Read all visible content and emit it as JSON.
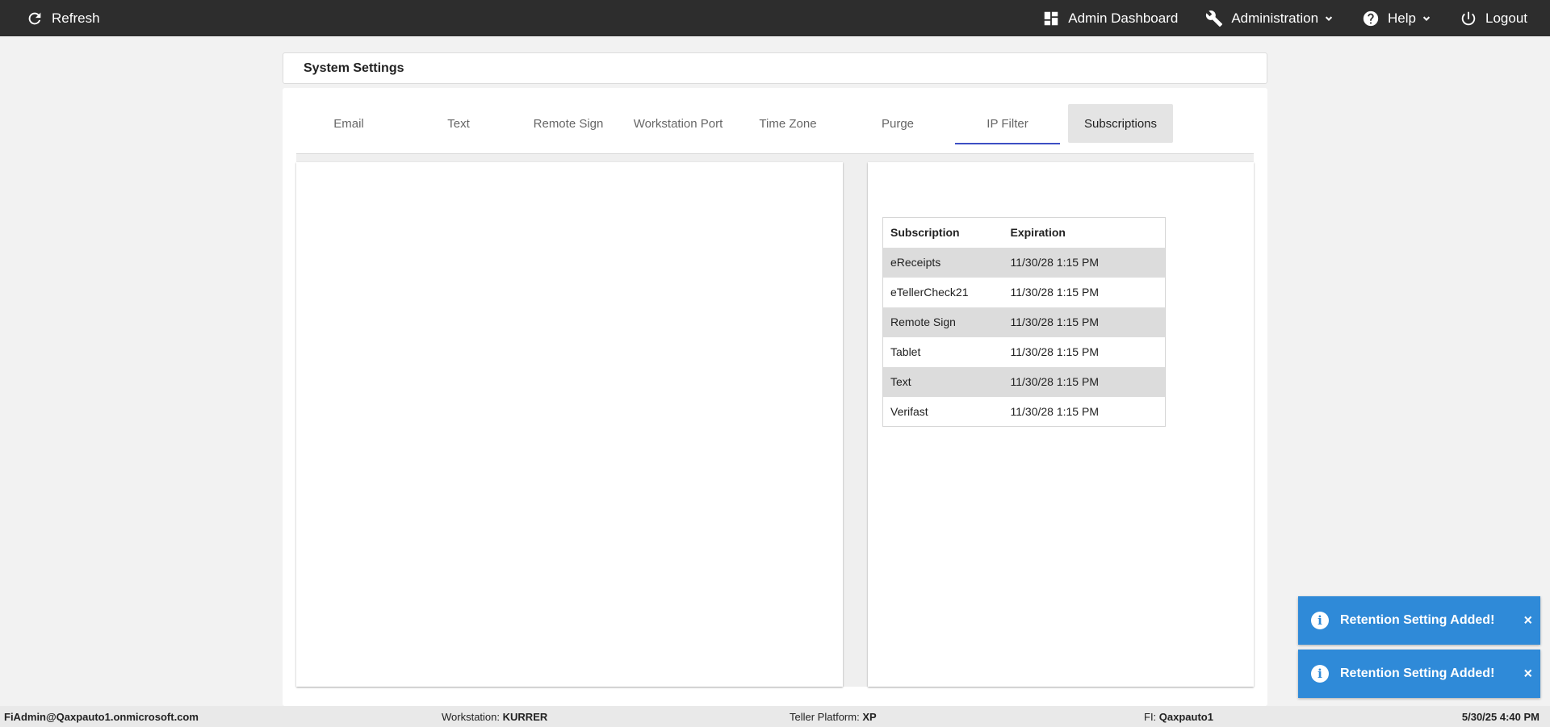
{
  "topbar": {
    "refresh_label": "Refresh",
    "admin_dashboard_label": "Admin Dashboard",
    "administration_label": "Administration",
    "help_label": "Help",
    "logout_label": "Logout"
  },
  "page": {
    "title": "System Settings"
  },
  "tabs": [
    {
      "label": "Email"
    },
    {
      "label": "Text"
    },
    {
      "label": "Remote Sign"
    },
    {
      "label": "Workstation Port"
    },
    {
      "label": "Time Zone"
    },
    {
      "label": "Purge"
    },
    {
      "label": "IP Filter"
    },
    {
      "label": "Subscriptions"
    }
  ],
  "subscriptions": {
    "headers": [
      "Subscription",
      "Expiration"
    ],
    "rows": [
      {
        "name": "eReceipts",
        "expiration": "11/30/28 1:15 PM"
      },
      {
        "name": "eTellerCheck21",
        "expiration": "11/30/28 1:15 PM"
      },
      {
        "name": "Remote Sign",
        "expiration": "11/30/28 1:15 PM"
      },
      {
        "name": "Tablet",
        "expiration": "11/30/28 1:15 PM"
      },
      {
        "name": "Text",
        "expiration": "11/30/28 1:15 PM"
      },
      {
        "name": "Verifast",
        "expiration": "11/30/28 1:15 PM"
      }
    ]
  },
  "statusbar": {
    "user": "FiAdmin@Qaxpauto1.onmicrosoft.com",
    "workstation_label": "Workstation:",
    "workstation_value": "KURRER",
    "teller_platform_label": "Teller Platform:",
    "teller_platform_value": "XP",
    "fi_label": "FI:",
    "fi_value": "Qaxpauto1",
    "datetime": "5/30/25 4:40 PM"
  },
  "toasts": [
    {
      "message": "Retention Setting Added!",
      "close": "×"
    },
    {
      "message": "Retention Setting Added!",
      "close": "×"
    }
  ],
  "colors": {
    "topbar_bg": "#2d2d2d",
    "tab_indicator": "#3d4fc4",
    "toast_bg": "#2f8ad8"
  }
}
